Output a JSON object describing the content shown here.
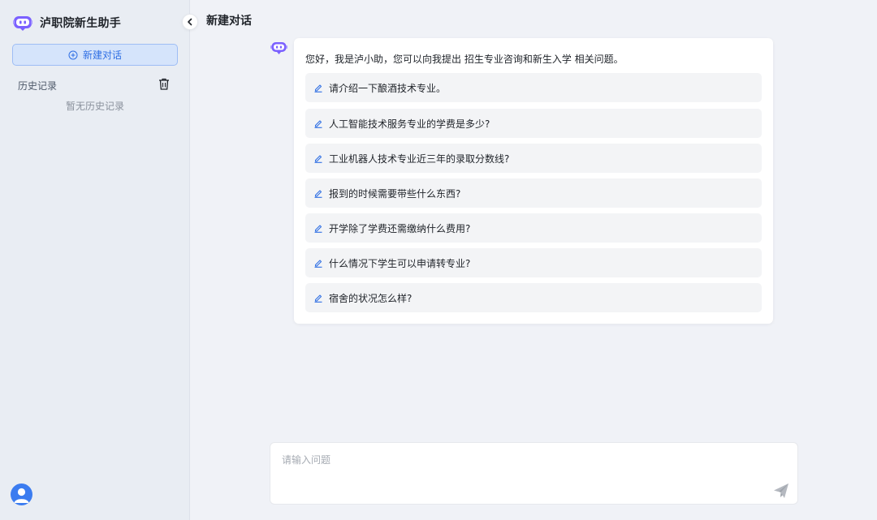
{
  "sidebar": {
    "app_title": "泸职院新生助手",
    "new_chat_label": "新建对话",
    "history_label": "历史记录",
    "history_empty": "暂无历史记录"
  },
  "main": {
    "title": "新建对话",
    "greeting": "您好，我是泸小助，您可以向我提出 招生专业咨询和新生入学 相关问题。",
    "suggestions": [
      "请介绍一下酿酒技术专业。",
      "人工智能技术服务专业的学费是多少?",
      "工业机器人技术专业近三年的录取分数线?",
      "报到的时候需要带些什么东西?",
      "开学除了学费还需缴纳什么费用?",
      "什么情况下学生可以申请转专业?",
      "宿舍的状况怎么样?"
    ]
  },
  "input": {
    "placeholder": "请输入问题"
  },
  "icons": {
    "logo": "robot-logo-icon",
    "new_chat": "plus-circle-icon",
    "history_delete": "trash-icon",
    "collapse": "chevron-left-icon",
    "bot": "robot-icon",
    "suggestion": "edit-pencil-icon",
    "send": "paper-plane-icon",
    "user": "user-avatar-icon"
  },
  "colors": {
    "accent": "#2f6fe4",
    "robot": "#6c5ce7",
    "sidebar_bg": "#e9edf3",
    "main_bg": "#f0f2f7"
  }
}
